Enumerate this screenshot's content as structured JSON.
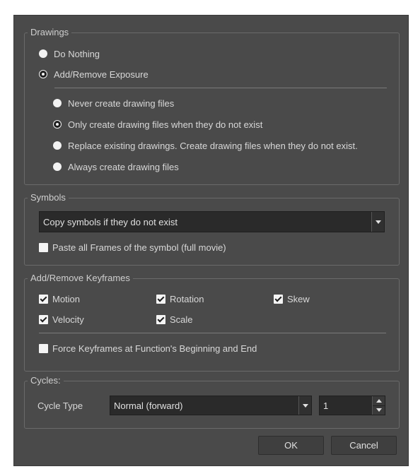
{
  "drawings": {
    "title": "Drawings",
    "options": [
      "Do Nothing",
      "Add/Remove Exposure"
    ],
    "selected_option": "Add/Remove Exposure",
    "sub_options": [
      "Never create drawing files",
      "Only create drawing files when they do not exist",
      "Replace existing drawings. Create drawing files when they do not exist.",
      "Always create drawing files"
    ],
    "selected_sub_option": "Only create drawing files when they do not exist"
  },
  "symbols": {
    "title": "Symbols",
    "dropdown_value": "Copy symbols if they do not exist",
    "paste_all_frames_label": "Paste all Frames of the symbol (full movie)",
    "paste_all_frames_checked": false
  },
  "keyframes": {
    "title": "Add/Remove Keyframes",
    "motion": "Motion",
    "rotation": "Rotation",
    "skew": "Skew",
    "velocity": "Velocity",
    "scale": "Scale",
    "force_label": "Force Keyframes at Function's Beginning and End",
    "force_checked": false
  },
  "cycles": {
    "title": "Cycles:",
    "cycle_type_label": "Cycle Type",
    "cycle_type_value": "Normal (forward)",
    "count_value": "1"
  },
  "buttons": {
    "ok": "OK",
    "cancel": "Cancel"
  }
}
